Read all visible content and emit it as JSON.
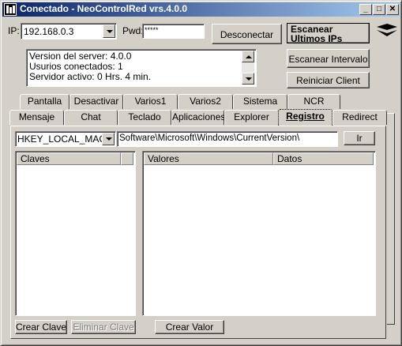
{
  "window": {
    "title": "Conectado - NeoControlRed vrs.4.0.0",
    "controls": {
      "minimize": "_",
      "maximize": "□",
      "close": "✕"
    }
  },
  "connection": {
    "ip_label": "IP:",
    "ip_value": "192.168.0.3",
    "pwd_label": "Pwd:",
    "pwd_value": "*****",
    "disconnect_label": "Desconectar"
  },
  "side_buttons": {
    "scan_last": "Escanear Ultimos IPs",
    "scan_interval": "Escanear Intervalo",
    "restart_client": "Reiniciar Client"
  },
  "server_info": {
    "lines": [
      "Version del server: 4.0.0",
      "Usurios conectados: 1",
      "Servidor activo: 0 Hrs. 4 min."
    ]
  },
  "tabs_row1": [
    "Pantalla",
    "Desactivar",
    "Varios1",
    "Varios2",
    "Sistema",
    "NCR"
  ],
  "tabs_row2": [
    "Mensaje",
    "Chat",
    "Teclado",
    "Aplicaciones",
    "Explorer",
    "Registro",
    "Redirect"
  ],
  "active_tab": "Registro",
  "registry": {
    "hive_value": "HKEY_LOCAL_MACH",
    "path_value": "Software\\Microsoft\\Windows\\CurrentVersion\\",
    "go_label": "Ir",
    "keys_header": "Claves",
    "values_header": "Valores",
    "data_header": "Datos",
    "create_key_label": "Crear Clave",
    "delete_key_label": "Eliminar Clave",
    "create_value_label": "Crear Valor"
  }
}
